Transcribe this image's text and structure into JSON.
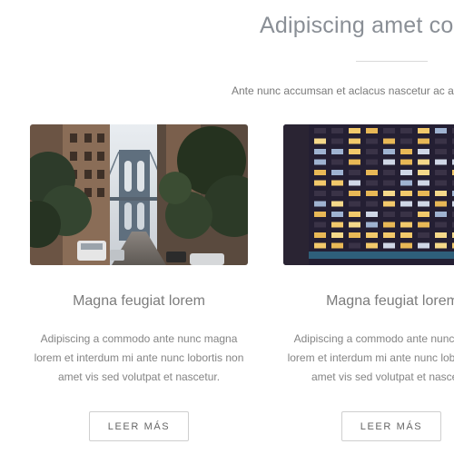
{
  "section": {
    "title": "Adipiscing amet con",
    "subtitle": "Ante nunc accumsan et aclacus nascetur ac ar"
  },
  "cards": [
    {
      "image_icon": "bridge-city-street-photo",
      "title": "Magna feugiat lorem",
      "text_lines": [
        "Adipiscing a commodo ante nunc magna",
        "lorem et interdum mi ante nunc lobortis non",
        "amet vis sed volutpat et nascetur."
      ],
      "button_label": "LEER MÁS"
    },
    {
      "image_icon": "office-building-night-photo",
      "title": "Magna feugiat lorem",
      "text_lines": [
        "Adipiscing a commodo ante nunc magna",
        "lorem et interdum mi ante nunc lobortis non",
        "amet vis sed volutpat et nascetur."
      ],
      "button_label": "LEER MÁS"
    }
  ],
  "colors": {
    "title": "#8a8f96",
    "text": "#858585",
    "button_border": "#cfcfcf"
  }
}
